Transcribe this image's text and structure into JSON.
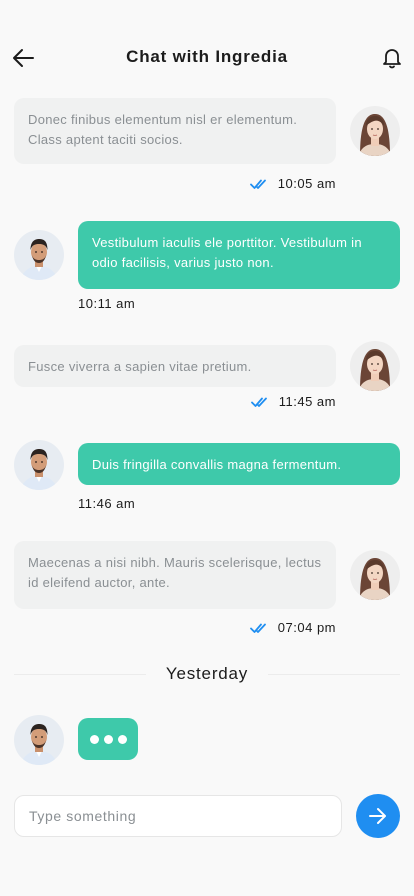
{
  "header": {
    "title": "Chat with Ingredia",
    "back_icon": "arrow-left-icon",
    "notification_icon": "bell-icon"
  },
  "colors": {
    "accent_green": "#3ec9aa",
    "send_blue": "#1f8ef1",
    "check_blue": "#1f8ef1",
    "incoming_bg": "#f0f1f1"
  },
  "messages": [
    {
      "direction": "in",
      "text": "Donec finibus elementum nisl er elementum. Class aptent taciti socios.",
      "time": "10:05 am",
      "read": true
    },
    {
      "direction": "out",
      "text": "Vestibulum iaculis ele porttitor. Vestibulum in odio facilisis, varius justo non.",
      "time": "10:11 am"
    },
    {
      "direction": "in",
      "text": "Fusce viverra a sapien vitae pretium.",
      "time": "11:45 am",
      "read": true
    },
    {
      "direction": "out",
      "text": "Duis fringilla convallis magna fermentum.",
      "time": "11:46 am"
    },
    {
      "direction": "in",
      "text": "Maecenas a nisi nibh. Mauris scelerisque, lectus id eleifend auctor, ante.",
      "time": "07:04 pm",
      "read": true
    }
  ],
  "divider": {
    "label": "Yesterday"
  },
  "composer": {
    "placeholder": "Type something",
    "value": "",
    "send_icon": "arrow-right-icon"
  }
}
